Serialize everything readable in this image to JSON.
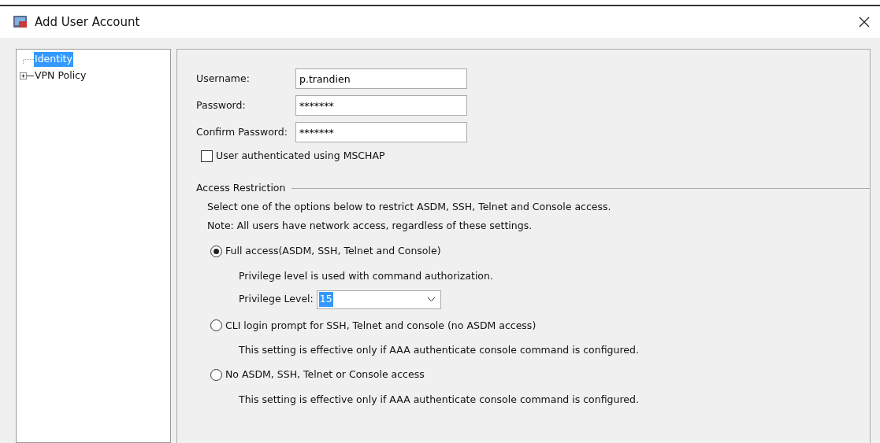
{
  "window": {
    "title": "Add User Account"
  },
  "tree": [
    {
      "label": "Identity",
      "selected": true
    },
    {
      "label": "VPN Policy",
      "selected": false,
      "expanded": false
    }
  ],
  "fields": [
    {
      "label": "Username:",
      "value": "p.trandien"
    },
    {
      "label": "Password:",
      "value": "*******"
    },
    {
      "label": "Confirm Password:",
      "value": "*******"
    }
  ],
  "mschap": {
    "label": "User authenticated using MSCHAP",
    "checked": false
  },
  "access_restriction": {
    "title": "Access Restriction",
    "intro": [
      "Select one of the options below to restrict ASDM, SSH, Telnet and Console access.",
      "Note: All users have network access, regardless of these settings."
    ],
    "options": [
      {
        "label": "Full access(ASDM, SSH, Telnet and Console)",
        "selected": true,
        "description": "Privilege level is used with command authorization.",
        "privilege": {
          "label": "Privilege Level:",
          "value": "15"
        }
      },
      {
        "label": "CLI login prompt for SSH, Telnet and console (no ASDM access)",
        "selected": false,
        "description": "This setting is effective only if AAA authenticate console command is configured."
      },
      {
        "label": "No ASDM, SSH, Telnet or Console access",
        "selected": false,
        "description": "This setting is effective only if AAA authenticate console command is configured."
      }
    ]
  }
}
